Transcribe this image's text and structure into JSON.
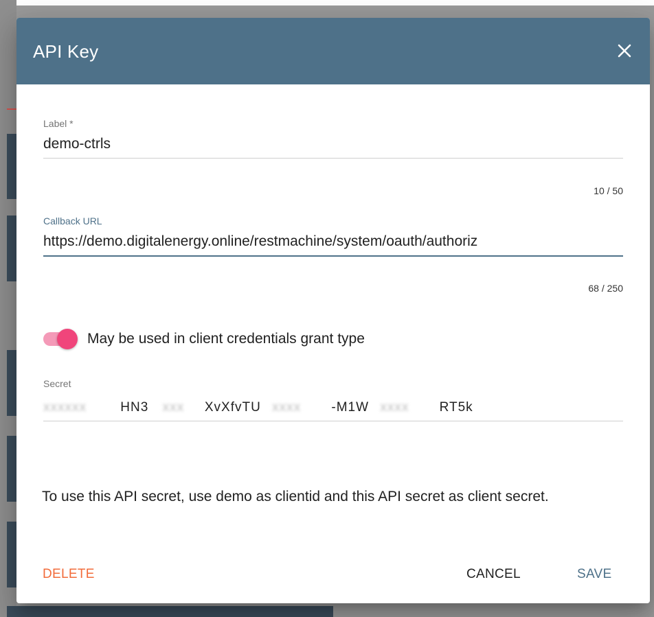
{
  "dialog": {
    "title": "API Key",
    "close_icon": "close-icon"
  },
  "label_field": {
    "label": "Label *",
    "value": "demo-ctrls",
    "counter": "10 / 50"
  },
  "callback_field": {
    "label": "Callback URL",
    "value": "https://demo.digitalenergy.online/restmachine/system/oauth/authoriz",
    "counter": "68 / 250"
  },
  "client_credentials_toggle": {
    "label": "May be used in client credentials grant type",
    "checked": true
  },
  "secret_field": {
    "label": "Secret",
    "parts": [
      "HN3",
      "XvXfvTU",
      "-M1W",
      "RT5k"
    ]
  },
  "info_text": "To use this API secret, use demo as clientid and this API secret as client secret.",
  "actions": {
    "delete_label": "DELETE",
    "cancel_label": "CANCEL",
    "save_label": "SAVE"
  },
  "colors": {
    "header": "#4e7189",
    "accent": "#4e7189",
    "delete": "#f26b3a",
    "toggle": "#f0457b"
  }
}
